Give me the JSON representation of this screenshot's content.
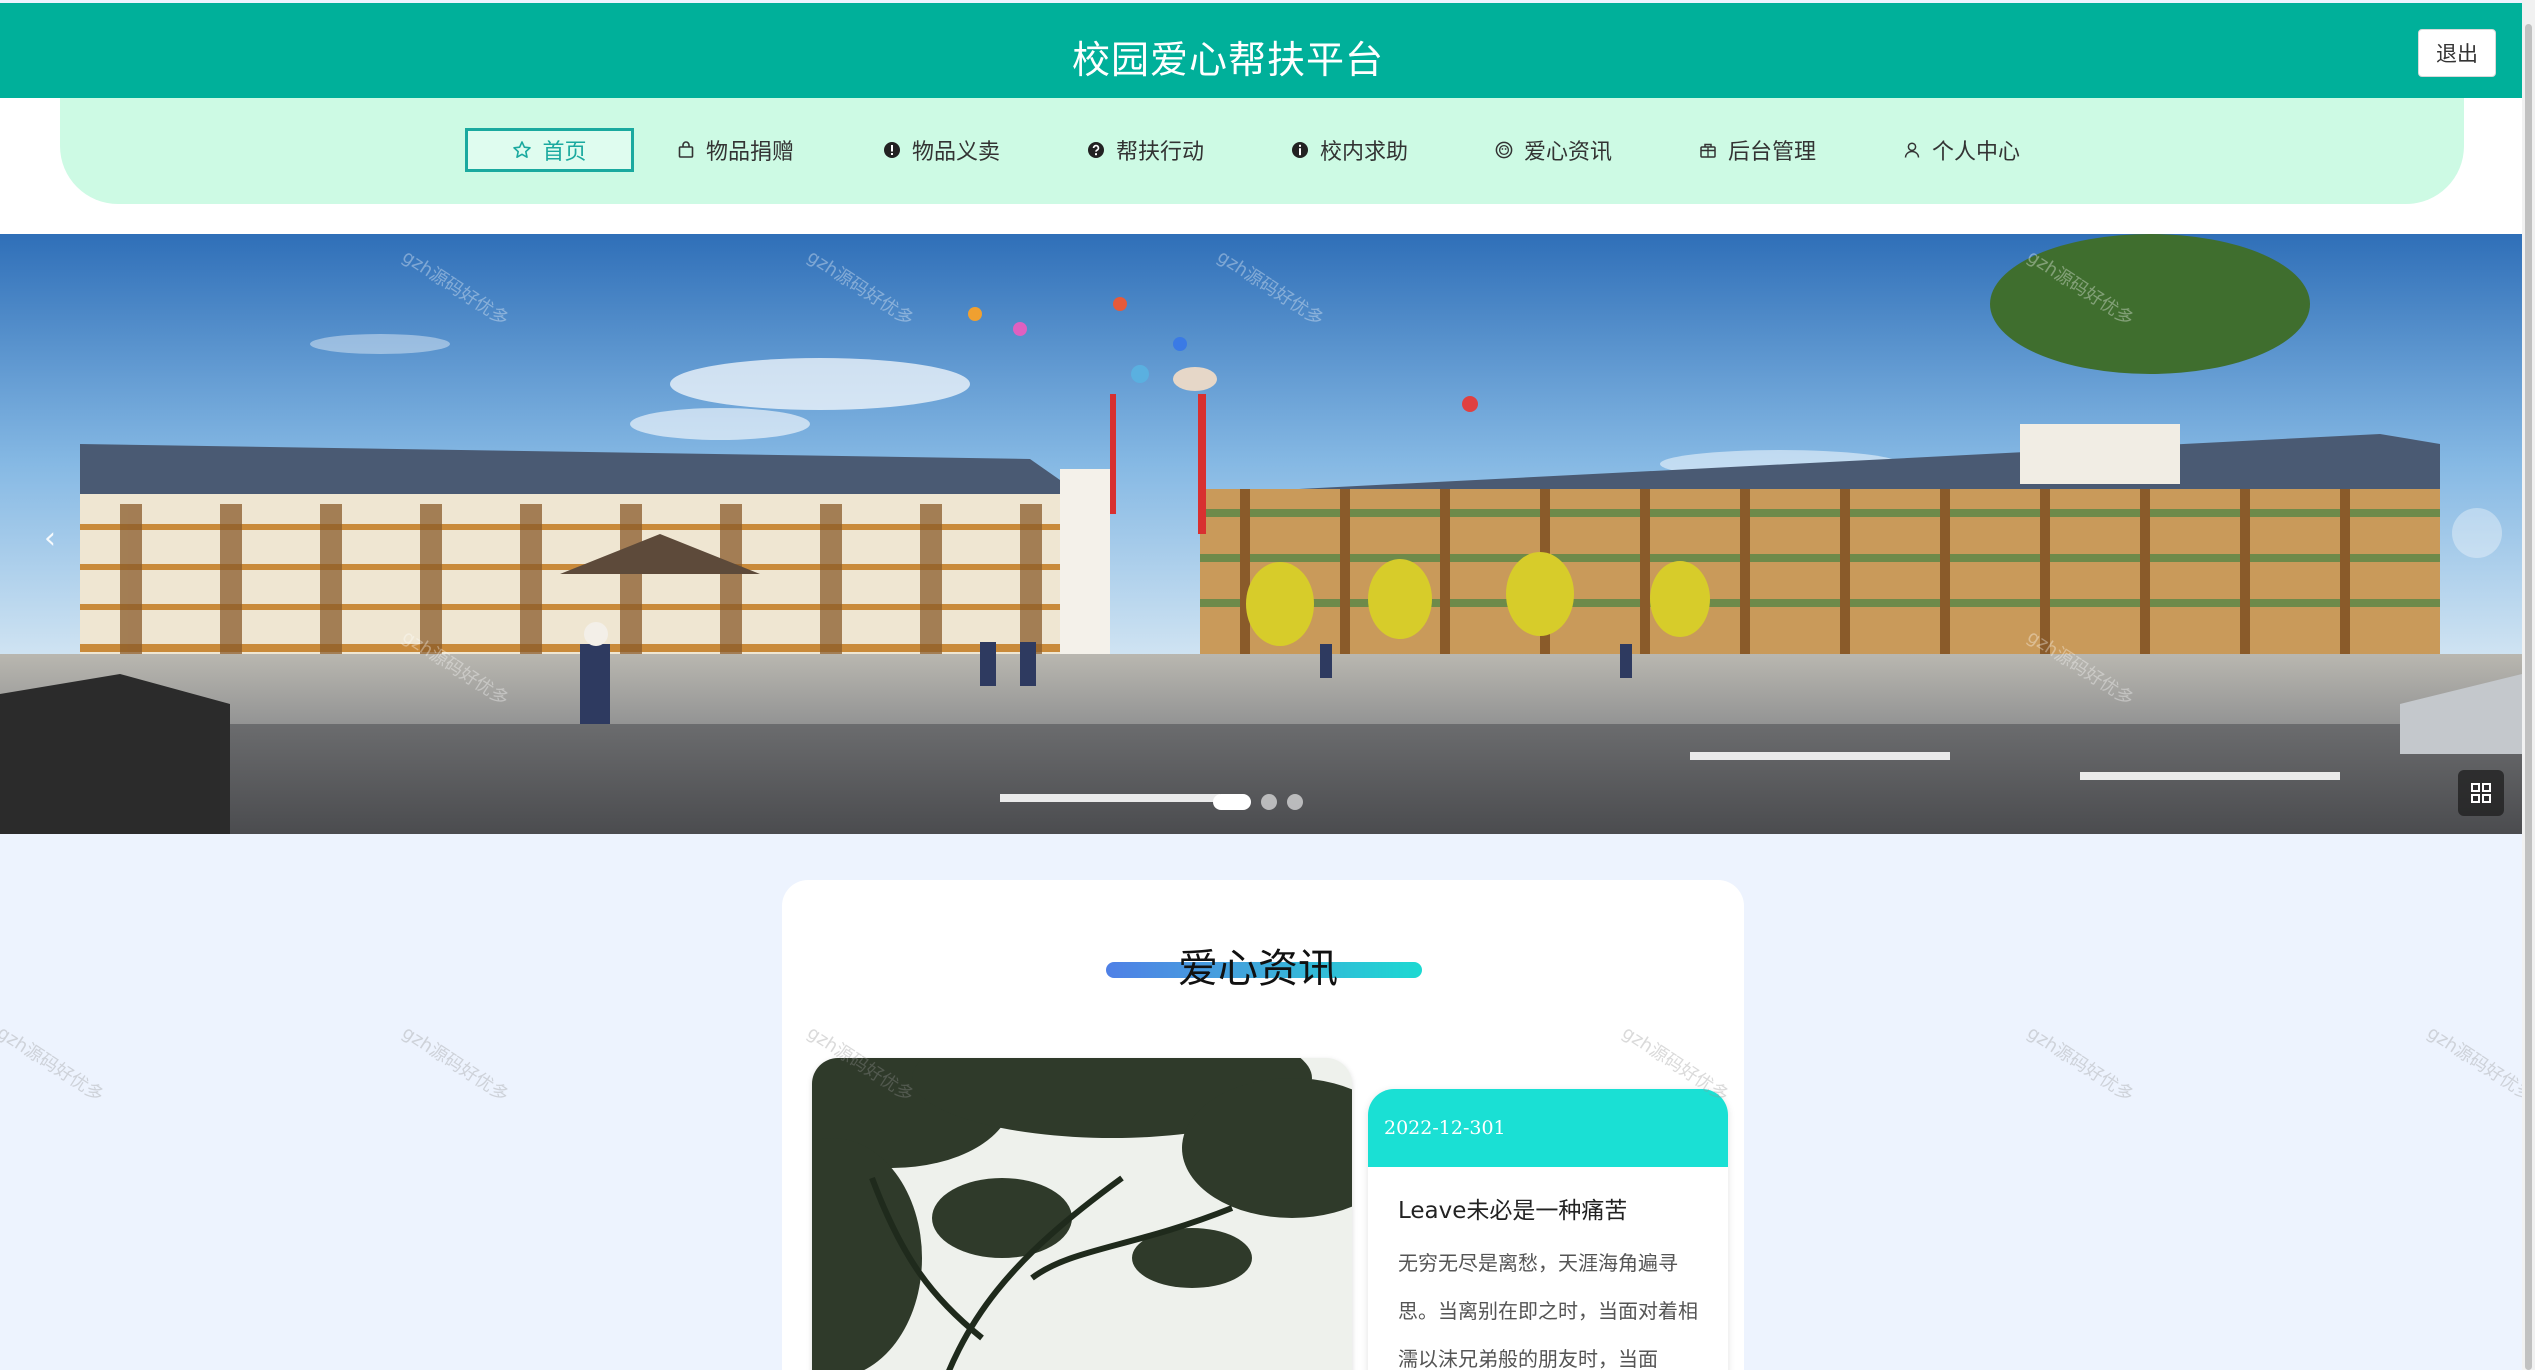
{
  "header": {
    "title": "校园爱心帮扶平台",
    "logout_label": "退出",
    "background_color": "#00b09a"
  },
  "nav": {
    "background_color": "#cdfae4",
    "active_color": "#1aa99f",
    "items": [
      {
        "label": "首页",
        "icon": "star-icon",
        "active": true
      },
      {
        "label": "物品捐赠",
        "icon": "shopping-bag-icon",
        "active": false
      },
      {
        "label": "物品义卖",
        "icon": "exclamation-circle-icon",
        "active": false
      },
      {
        "label": "帮扶行动",
        "icon": "question-circle-icon",
        "active": false
      },
      {
        "label": "校内求助",
        "icon": "info-circle-icon",
        "active": false
      },
      {
        "label": "爱心资讯",
        "icon": "smile-icon",
        "active": false
      },
      {
        "label": "后台管理",
        "icon": "gift-icon",
        "active": false
      },
      {
        "label": "个人中心",
        "icon": "user-icon",
        "active": false
      }
    ]
  },
  "banner": {
    "slide_count": 3,
    "active_slide": 1,
    "prev_icon": "chevron-left-icon",
    "grid_icon": "grid-icon"
  },
  "news": {
    "section_title": "爱心资讯",
    "item": {
      "date": "2022-12-301",
      "title": "Leave未必是一种痛苦",
      "summary": "无穷无尽是离愁，天涯海角遍寻思。当离别在即之时，当面对着相濡以沫兄弟般的朋友时，当面"
    }
  },
  "watermark": "gzh源码好优多"
}
